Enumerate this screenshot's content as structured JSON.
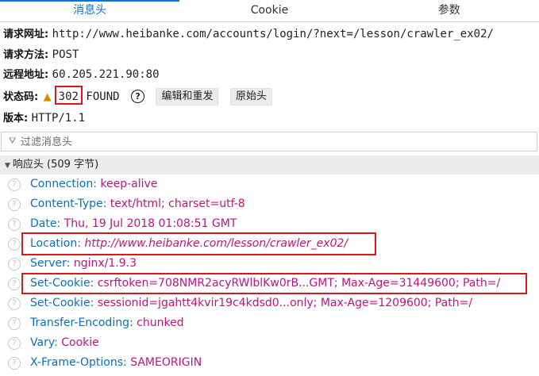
{
  "tabs": [
    {
      "label": "消息头"
    },
    {
      "label": "Cookie"
    },
    {
      "label": "参数"
    }
  ],
  "general": {
    "url_label": "请求网址:",
    "url_value": "http://www.heibanke.com/accounts/login/?next=/lesson/crawler_ex02/",
    "method_label": "请求方法:",
    "method_value": "POST",
    "remote_label": "远程地址:",
    "remote_value": "60.205.221.90:80",
    "status_label": "状态码:",
    "status_code": "302",
    "status_text": "FOUND",
    "help_icon": "question-circle-icon",
    "edit_resend_label": "编辑和重发",
    "raw_headers_label": "原始头",
    "version_label": "版本:",
    "version_value": "HTTP/1.1"
  },
  "filter": {
    "placeholder": "过滤消息头",
    "icon": "filter-funnel-icon"
  },
  "response_section": {
    "title": "响应头 (509 字节)"
  },
  "headers": [
    {
      "name": "Connection:",
      "value": "keep-alive"
    },
    {
      "name": "Content-Type:",
      "value": "text/html; charset=utf-8"
    },
    {
      "name": "Date:",
      "value": "Thu, 19 Jul 2018 01:08:51 GMT"
    },
    {
      "name": "Location:",
      "value": "http://www.heibanke.com/lesson/crawler_ex02/"
    },
    {
      "name": "Server:",
      "value": "nginx/1.9.3"
    },
    {
      "name": "Set-Cookie:",
      "value": "csrftoken=708NMR2acyRWlblKw0rB...GMT; Max-Age=31449600; Path=/"
    },
    {
      "name": "Set-Cookie:",
      "value": "sessionid=jgahtt4kvir19c4kdsd0...only; Max-Age=1209600; Path=/"
    },
    {
      "name": "Transfer-Encoding:",
      "value": "chunked"
    },
    {
      "name": "Vary:",
      "value": "Cookie"
    },
    {
      "name": "X-Frame-Options:",
      "value": "SAMEORIGIN"
    }
  ],
  "colors": {
    "accent": "#0a74d1",
    "header_name": "#0a6fc2",
    "header_value": "#c5117b",
    "highlight_box": "#e01515",
    "warning": "#d98b00"
  }
}
